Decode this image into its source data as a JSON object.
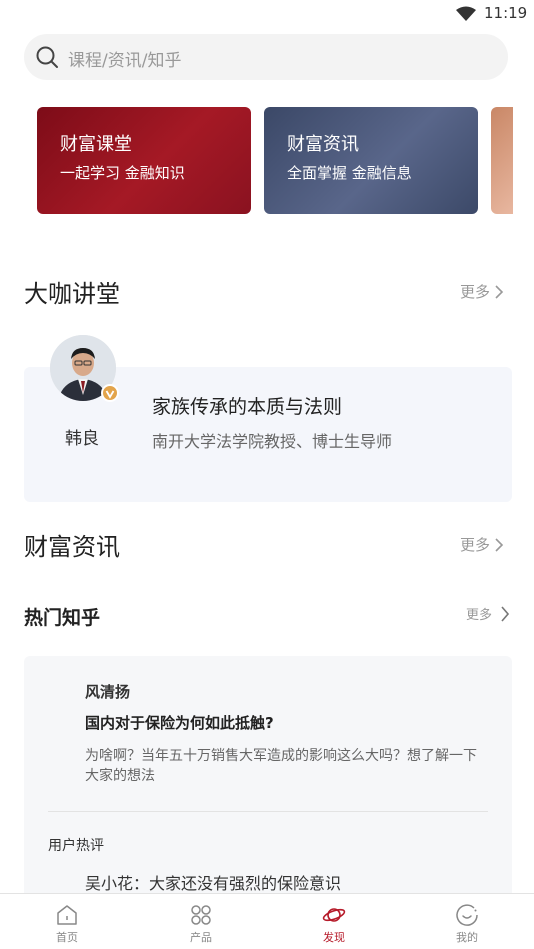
{
  "status_bar": {
    "time": "11:19"
  },
  "search": {
    "placeholder": "课程/资讯/知乎"
  },
  "banners": [
    {
      "title": "财富课堂",
      "subtitle": "一起学习 金融知识"
    },
    {
      "title": "财富资讯",
      "subtitle": "全面掌握 金融信息"
    }
  ],
  "lecture_section": {
    "title": "大咖讲堂",
    "more": "更多",
    "speaker": "韩良",
    "lecture_title": "家族传承的本质与法则",
    "lecture_desc": "南开大学法学院教授、博士生导师"
  },
  "news_section": {
    "title": "财富资讯",
    "more": "更多"
  },
  "hot_section": {
    "title": "热门知乎",
    "more": "更多",
    "user": "风清扬",
    "question": "国内对于保险为何如此抵触?",
    "description": "为啥啊？当年五十万销售大军造成的影响这么大吗？想了解一下大家的想法",
    "hot_label": "用户热评",
    "comment": "吴小花：大家还没有强烈的保险意识"
  },
  "tabbar": {
    "items": [
      {
        "label": "首页",
        "icon": "home-icon"
      },
      {
        "label": "产品",
        "icon": "grid-icon"
      },
      {
        "label": "发现",
        "icon": "planet-icon",
        "active": true
      },
      {
        "label": "我的",
        "icon": "profile-icon"
      }
    ],
    "active_color": "#b61b2a"
  }
}
